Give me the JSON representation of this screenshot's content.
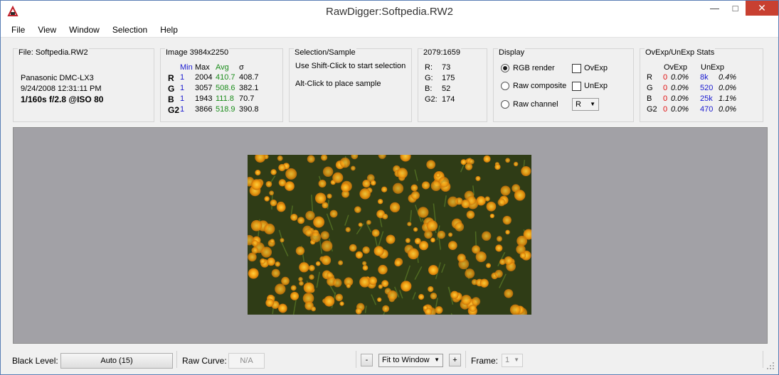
{
  "window": {
    "title": "RawDigger:Softpedia.RW2"
  },
  "menu": [
    "File",
    "View",
    "Window",
    "Selection",
    "Help"
  ],
  "file_panel": {
    "title": "File: Softpedia.RW2",
    "camera": "Panasonic DMC-LX3",
    "datetime": "9/24/2008 12:31:11 PM",
    "exposure": "1/160s f/2.8 @ISO 80"
  },
  "image_panel": {
    "title": "Image 3984x2250",
    "headers": {
      "min": "Min",
      "max": "Max",
      "avg": "Avg",
      "sigma": "σ"
    },
    "rows": [
      {
        "ch": "R",
        "min": "1",
        "max": "2004",
        "avg": "410.7",
        "sigma": "408.7"
      },
      {
        "ch": "G",
        "min": "1",
        "max": "3057",
        "avg": "508.6",
        "sigma": "382.1"
      },
      {
        "ch": "B",
        "min": "1",
        "max": "1943",
        "avg": "111.8",
        "sigma": "70.7"
      },
      {
        "ch": "G2",
        "min": "1",
        "max": "3866",
        "avg": "518.9",
        "sigma": "390.8"
      }
    ]
  },
  "selection_panel": {
    "title": "Selection/Sample",
    "line1": "Use Shift-Click to start selection",
    "line2": "Alt-Click to place sample"
  },
  "coord_panel": {
    "title": "2079:1659",
    "rows": [
      {
        "label": "R:",
        "value": "73"
      },
      {
        "label": "G:",
        "value": "175"
      },
      {
        "label": "B:",
        "value": "52"
      },
      {
        "label": "G2:",
        "value": "174"
      }
    ]
  },
  "display_panel": {
    "title": "Display",
    "radios": [
      "RGB render",
      "Raw composite",
      "Raw channel"
    ],
    "selected": "RGB render",
    "checks": [
      "OvExp",
      "UnExp"
    ],
    "channel_select": "R"
  },
  "stats_panel": {
    "title": "OvExp/UnExp Stats",
    "headers": {
      "ov": "OvExp",
      "un": "UnExp"
    },
    "rows": [
      {
        "ch": "R",
        "ov": "0",
        "ovp": "0.0%",
        "un": "8k",
        "unp": "0.4%"
      },
      {
        "ch": "G",
        "ov": "0",
        "ovp": "0.0%",
        "un": "520",
        "unp": "0.0%"
      },
      {
        "ch": "B",
        "ov": "0",
        "ovp": "0.0%",
        "un": "25k",
        "unp": "1.1%"
      },
      {
        "ch": "G2",
        "ov": "0",
        "ovp": "0.0%",
        "un": "470",
        "unp": "0.0%"
      }
    ]
  },
  "statusbar": {
    "black_level_label": "Black Level:",
    "black_level_value": "Auto (15)",
    "raw_curve_label": "Raw Curve:",
    "raw_curve_value": "N/A",
    "zoom_minus": "-",
    "zoom_select": "Fit to Window",
    "zoom_plus": "+",
    "frame_label": "Frame:",
    "frame_value": "1"
  },
  "colors": {
    "viewport_bg": "#a2a1a6",
    "close_button": "#c84031",
    "min_blue": "#1a1ad0",
    "avg_green": "#1a8c1a",
    "ov_red": "#e01010"
  }
}
